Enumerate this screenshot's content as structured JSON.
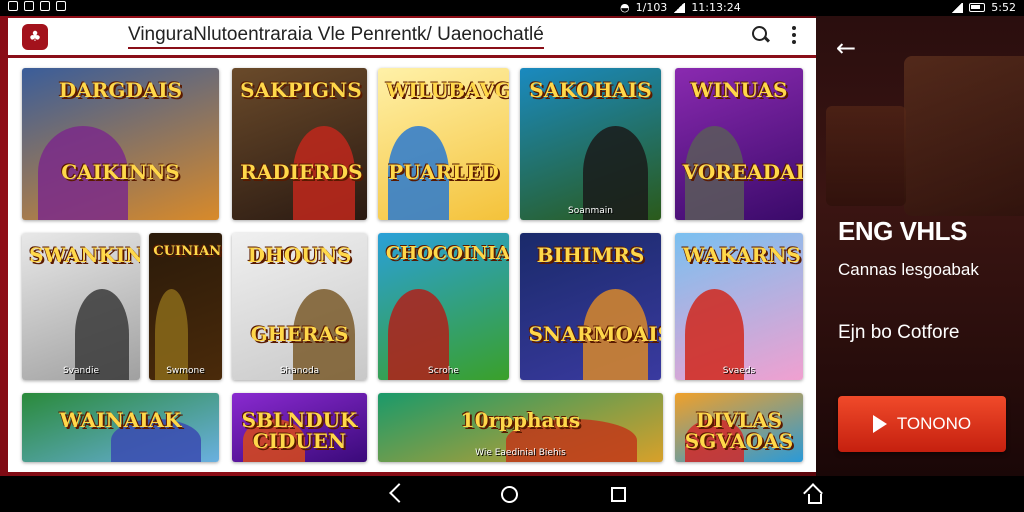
{
  "status_bar": {
    "center_text": "1/103",
    "time_center": "11:13:24",
    "time_right": "5:52"
  },
  "app_bar": {
    "title": "VinguraNlutoentraraia Vle Penrentk/  Uaenochatlé"
  },
  "grid": {
    "tiles": [
      {
        "title": "DARGDAIS",
        "title2": "CAIKINNS",
        "sub": "",
        "bg": [
          "#3a5d9a",
          "#d88a2a"
        ],
        "hero": "#7a2a8a"
      },
      {
        "title": "SAKPIGNS",
        "title2": "RADIERDS",
        "sub": "",
        "bg": [
          "#6a4a2a",
          "#2a1a12"
        ],
        "hero": "#c0281c"
      },
      {
        "title": "WILUBAVG",
        "title2": "PUARLED",
        "sub": "",
        "bg": [
          "#fff1a8",
          "#f4c23a"
        ],
        "hero": "#2a7ad0"
      },
      {
        "title": "SAKOHAIS",
        "title2": "",
        "sub": "Soanmain",
        "bg": [
          "#1a8ac0",
          "#2a5a1a"
        ],
        "hero": "#1a1a1a"
      },
      {
        "title": "WINUAS",
        "title2": "VOREADAIE",
        "sub": "",
        "bg": [
          "#8a2ab0",
          "#3a0a6a"
        ],
        "hero": "#5a5a5a"
      },
      {
        "title": "SWANKINE",
        "title2": "",
        "sub": "Svandie",
        "bg": [
          "#e8e8e8",
          "#a0a0a0"
        ],
        "hero": "#3a3a3a"
      },
      {
        "title": "CUINIANS",
        "title2": "",
        "sub": "Swmone",
        "bg": [
          "#2a1a0a",
          "#4a2a0a"
        ],
        "hero": "#8a6a1a"
      },
      {
        "title": "DHOUNS",
        "title2": "GHERAS",
        "sub": "Shanoda",
        "bg": [
          "#f0f0f0",
          "#c8c8c8"
        ],
        "hero": "#7a5a2a"
      },
      {
        "title": "CHOCOINIAL",
        "title2": "",
        "sub": "Scrohe",
        "bg": [
          "#2aa0d8",
          "#3aa02a"
        ],
        "hero": "#b0201a"
      },
      {
        "title": "BIHIMRS",
        "title2": "SNARMOAIS",
        "sub": "",
        "bg": [
          "#1a2a6a",
          "#3a3aa0"
        ],
        "hero": "#d8882a"
      },
      {
        "title": "WAKARNS",
        "title2": "",
        "sub": "Svaeds",
        "bg": [
          "#7ac0f0",
          "#f0a0d0"
        ],
        "hero": "#d0281c"
      },
      {
        "title": "WAINAIAK",
        "title2": "",
        "sub": "",
        "bg": [
          "#2a8a3a",
          "#6ab0e0"
        ],
        "hero": "#3a4ab0"
      },
      {
        "title": "SBLNDUK",
        "title2": "CIDUEN",
        "sub": "",
        "bg": [
          "#8a2ad0",
          "#3a0a7a"
        ],
        "hero": "#d84a1a"
      },
      {
        "title": "10rpphaus",
        "title2": "",
        "sub": "Wie Eaedinial Biehis",
        "bg": [
          "#1a9a6a",
          "#d8a02a"
        ],
        "hero": "#c0381a"
      },
      {
        "title": "DIVLAS",
        "title2": "SGVAOAS",
        "sub": "",
        "bg": [
          "#f0a02a",
          "#2a9ad8"
        ],
        "hero": "#d02a2a"
      }
    ]
  },
  "right_panel": {
    "back_icon": "arrow-left-icon",
    "title": "ENG VHLS",
    "subtitle": "Cannas lesgoabak",
    "link": "Ejn bo Cotfore",
    "button_label": "TONONO"
  },
  "nav_bar": {
    "icons": [
      "back-icon",
      "home-icon",
      "recents-icon",
      "home-outline-icon"
    ]
  }
}
